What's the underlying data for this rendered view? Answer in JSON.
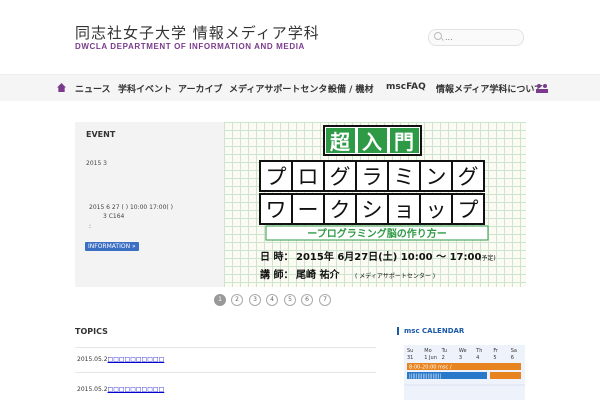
{
  "header": {
    "title": "同志社女子大学 情報メディア学科",
    "subtitle": "DWCLA DEPARTMENT OF INFORMATION AND MEDIA",
    "search_placeholder": "..."
  },
  "nav": {
    "items": [
      "ニュース",
      "学科イベント",
      "アーカイブ",
      "メディアサポートセンター",
      "設備 / 機材",
      "mscFAQ",
      "情報メディア学科について"
    ]
  },
  "event": {
    "heading": "EVENT",
    "line1": "2015        3",
    "line2": "2015 6 27 ( ) 10:00 17:00( )",
    "line3": "3 C164",
    "line4": ":",
    "button": "INFORMATION »"
  },
  "poster": {
    "banner_chars": [
      "超",
      "入",
      "門"
    ],
    "row1_chars": [
      "プ",
      "ロ",
      "グ",
      "ラ",
      "ミ",
      "ン",
      "グ"
    ],
    "row2_chars": [
      "ワ",
      "ー",
      "ク",
      "シ",
      "ョ",
      "ッ",
      "プ"
    ],
    "tagline": "ープログラミング脳の作り方ー",
    "date_label": "日 時：",
    "date_value": "2015年 6月27日(土) 10:00 〜 17:00",
    "date_note": "(予定)",
    "lecturer_label": "講 師：",
    "lecturer_value": "尾崎 祐介",
    "lecturer_note": "( メディアサポートセンター )"
  },
  "pager": [
    "1",
    "2",
    "3",
    "4",
    "5",
    "6",
    "7"
  ],
  "pager_active": "1",
  "topics": {
    "heading": "TOPICS",
    "items": [
      {
        "date": "2015.05.2",
        "title": "□□□□□□□□□□"
      },
      {
        "date": "2015.05.2",
        "title": "□□□□□□□□□□"
      }
    ]
  },
  "calendar": {
    "heading": "msc CALENDAR",
    "weekdays": [
      "Su",
      "Mo",
      "Tu",
      "We",
      "Th",
      "Fr",
      "Sa"
    ],
    "first_row": [
      "31",
      "1 Jun",
      "2",
      "3",
      "4",
      "5",
      "6"
    ],
    "event1": "8:00-20:00 msc /",
    "event2": "|||||||||||||||||||"
  },
  "colors": {
    "accent": "#7a3b8c",
    "poster_green": "#2e9a45",
    "link_blue": "#3b6fc4",
    "cal_blue": "#1a5aaa"
  }
}
